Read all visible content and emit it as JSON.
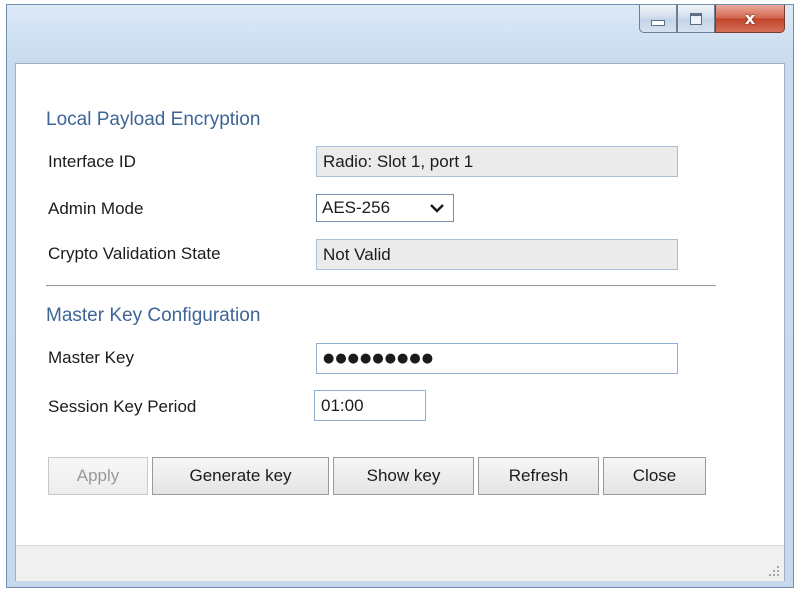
{
  "window": {
    "controls": {
      "minimize_icon": "minimize-icon",
      "maximize_icon": "maximize-icon",
      "close_glyph": "x"
    }
  },
  "local_payload": {
    "title": "Local Payload Encryption",
    "interface_id_label": "Interface ID",
    "interface_id_value": "Radio: Slot 1, port 1",
    "admin_mode_label": "Admin Mode",
    "admin_mode_value": "AES-256",
    "crypto_state_label": "Crypto Validation State",
    "crypto_state_value": "Not Valid"
  },
  "master_key": {
    "title": "Master Key Configuration",
    "master_key_label": "Master Key",
    "master_key_value": "●●●●●●●●●",
    "session_period_label": "Session Key Period",
    "session_period_value": "01:00"
  },
  "buttons": {
    "apply": "Apply",
    "generate": "Generate key",
    "show": "Show key",
    "refresh": "Refresh",
    "close": "Close"
  },
  "colors": {
    "section_title": "#3e6596",
    "close_button": "#c2452b"
  }
}
